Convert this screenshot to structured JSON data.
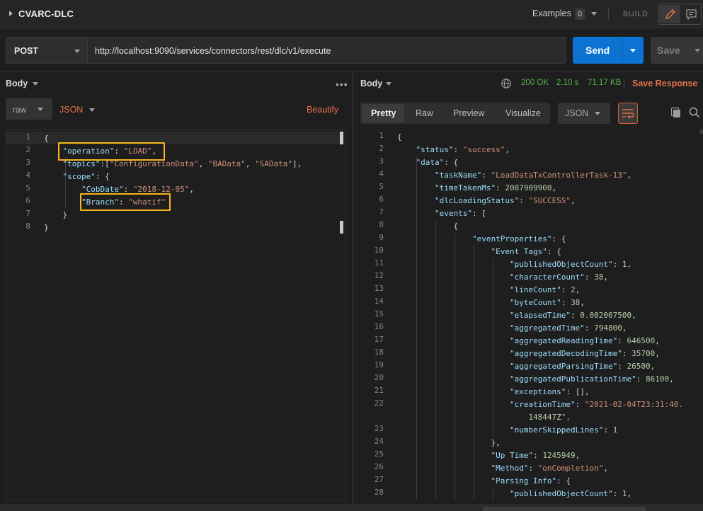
{
  "header": {
    "request_name": "CVARC-DLC",
    "examples_label": "Examples",
    "examples_count": "0",
    "build_label": "BUILD",
    "icons": [
      "collapse-arrow-icon",
      "pencil-icon",
      "comment-icon"
    ]
  },
  "request": {
    "method": "POST",
    "url": "http://localhost:9090/services/connectors/rest/dlc/v1/execute",
    "send_label": "Send",
    "save_label": "Save"
  },
  "request_body": {
    "title": "Body",
    "mode": "raw",
    "format": "JSON",
    "beautify_label": "Beautify",
    "lines": [
      "{",
      "    \"operation\": \"LOAD\",",
      "    \"topics\":[\"ConfigurationData\", \"BAData\", \"SAData\"],",
      "    \"scope\": {",
      "        \"CobDate\": \"2018-12-05\",",
      "        \"Branch\": \"whatif\"",
      "    }",
      "}"
    ]
  },
  "response": {
    "title": "Body",
    "status_code": "200 OK",
    "time": "2.10 s",
    "size": "71.17 KB",
    "save_response_label": "Save Response",
    "tabs": [
      "Pretty",
      "Raw",
      "Preview",
      "Visualize"
    ],
    "active_tab": "Pretty",
    "format": "JSON",
    "lines": [
      {
        "n": "1",
        "t": "{"
      },
      {
        "n": "2",
        "t": "    \"status\": \"success\","
      },
      {
        "n": "3",
        "t": "    \"data\": {"
      },
      {
        "n": "4",
        "t": "        \"taskName\": \"LoadDataTxControllerTask-13\","
      },
      {
        "n": "5",
        "t": "        \"timeTakenMs\": 2087909900,"
      },
      {
        "n": "6",
        "t": "        \"dlcLoadingStatus\": \"SUCCESS\","
      },
      {
        "n": "7",
        "t": "        \"events\": ["
      },
      {
        "n": "8",
        "t": "            {"
      },
      {
        "n": "9",
        "t": "                \"eventProperties\": {"
      },
      {
        "n": "10",
        "t": "                    \"Event Tags\": {"
      },
      {
        "n": "11",
        "t": "                        \"publishedObjectCount\": 1,"
      },
      {
        "n": "12",
        "t": "                        \"characterCount\": 38,"
      },
      {
        "n": "13",
        "t": "                        \"lineCount\": 2,"
      },
      {
        "n": "14",
        "t": "                        \"byteCount\": 38,"
      },
      {
        "n": "15",
        "t": "                        \"elapsedTime\": 0.002007500,"
      },
      {
        "n": "16",
        "t": "                        \"aggregatedTime\": 794800,"
      },
      {
        "n": "17",
        "t": "                        \"aggregatedReadingTime\": 646500,"
      },
      {
        "n": "18",
        "t": "                        \"aggregatedDecodingTime\": 35700,"
      },
      {
        "n": "19",
        "t": "                        \"aggregatedParsingTime\": 26500,"
      },
      {
        "n": "20",
        "t": "                        \"aggregatedPublicationTime\": 86100,"
      },
      {
        "n": "21",
        "t": "                        \"exceptions\": [],"
      },
      {
        "n": "22",
        "t": "                        \"creationTime\": \"2021-02-04T23:31:40."
      },
      {
        "n": "",
        "t": "                            148447Z\","
      },
      {
        "n": "23",
        "t": "                        \"numberSkippedLines\": 1"
      },
      {
        "n": "24",
        "t": "                    },"
      },
      {
        "n": "25",
        "t": "                    \"Up Time\": 1245949,"
      },
      {
        "n": "26",
        "t": "                    \"Method\": \"onCompletion\","
      },
      {
        "n": "27",
        "t": "                    \"Parsing Info\": {"
      },
      {
        "n": "28",
        "t": "                        \"publishedObjectCount\": 1,"
      }
    ]
  }
}
